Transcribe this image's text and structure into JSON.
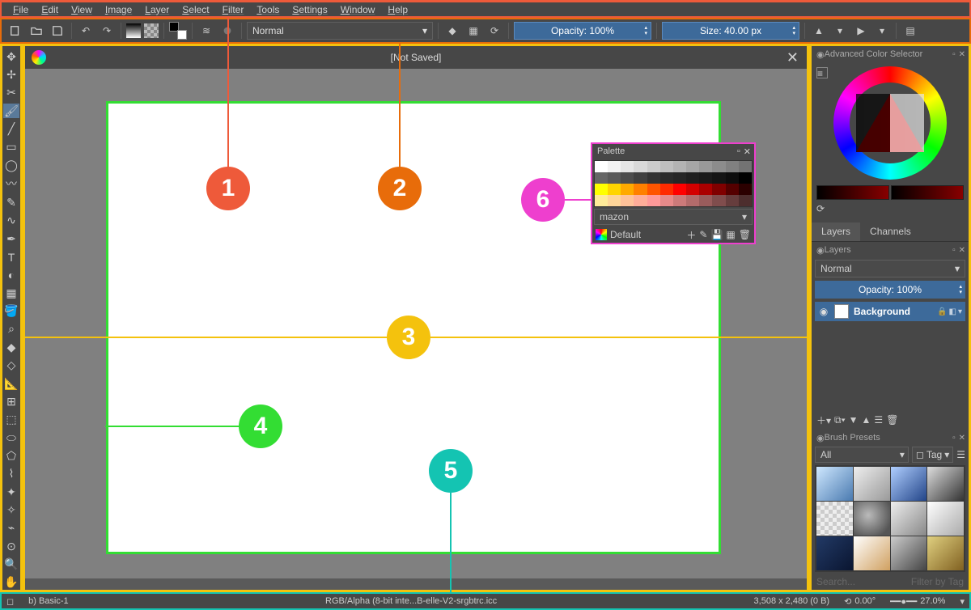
{
  "menu": [
    "File",
    "Edit",
    "View",
    "Image",
    "Layer",
    "Select",
    "Filter",
    "Tools",
    "Settings",
    "Window",
    "Help"
  ],
  "toolbar": {
    "blend_mode": "Normal",
    "opacity_label": "Opacity: 100%",
    "size_label": "Size: 40.00 px"
  },
  "document": {
    "title": "[Not Saved]"
  },
  "palette": {
    "title": "Palette",
    "set_name": "mazon",
    "footer_label": "Default",
    "rows": [
      [
        "#ffffff",
        "#f2f2f2",
        "#e6e6e6",
        "#d9d9d9",
        "#cccccc",
        "#bfbfbf",
        "#b3b3b3",
        "#a6a6a6",
        "#999999",
        "#8c8c8c",
        "#808080",
        "#737373"
      ],
      [
        "#666666",
        "#595959",
        "#4d4d4d",
        "#404040",
        "#333333",
        "#2b2b2b",
        "#262626",
        "#1f1f1f",
        "#1a1a1a",
        "#141414",
        "#0d0d0d",
        "#000000"
      ],
      [
        "#ffff00",
        "#ffd500",
        "#ffaa00",
        "#ff8000",
        "#ff5500",
        "#ff2b00",
        "#ff0000",
        "#d40000",
        "#aa0000",
        "#800000",
        "#550000",
        "#2b0000"
      ],
      [
        "#ffeb99",
        "#ffd699",
        "#ffc299",
        "#ffad99",
        "#ff9999",
        "#e68a8a",
        "#cc7a7a",
        "#b36b6b",
        "#995c5c",
        "#804d4d",
        "#663d3d",
        "#4d2e2e"
      ]
    ]
  },
  "color_selector": {
    "title": "Advanced Color Selector"
  },
  "layers": {
    "tabs": [
      "Layers",
      "Channels"
    ],
    "panel_title": "Layers",
    "blend_mode": "Normal",
    "opacity_label": "Opacity: 100%",
    "items": [
      {
        "name": "Background"
      }
    ]
  },
  "brush_presets": {
    "title": "Brush Presets",
    "filter": "All",
    "tag_label": "Tag",
    "search_placeholder": "Search...",
    "filter_tag": "Filter by Tag"
  },
  "status": {
    "brush": "b) Basic-1",
    "colorspace": "RGB/Alpha (8-bit inte...B-elle-V2-srgbtrc.icc",
    "dims": "3,508 x 2,480 (0 B)",
    "angle": "0.00°",
    "zoom": "27.0%"
  },
  "callouts": [
    "1",
    "2",
    "3",
    "4",
    "5",
    "6"
  ]
}
